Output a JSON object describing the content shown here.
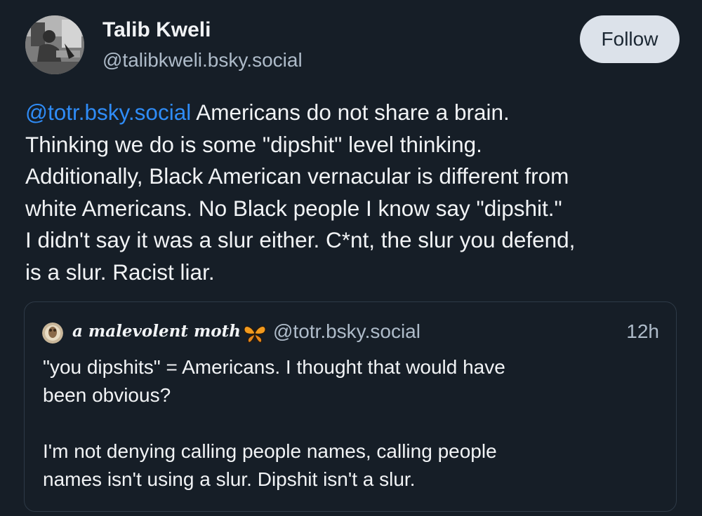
{
  "post": {
    "author": {
      "display_name": "Talib Kweli",
      "handle": "@talibkweli.bsky.social"
    },
    "follow_label": "Follow",
    "mention": "@totr.bsky.social",
    "text_lines": [
      " Americans do not share a brain.",
      "Thinking we do is some \"dipshit\" level thinking.",
      "Additionally, Black American vernacular is different from",
      "white Americans. No Black people I know say \"dipshit.\"",
      "I didn't say it was a slur either. C*nt, the slur you defend,",
      "is a slur. Racist liar."
    ]
  },
  "quote": {
    "display_name": "a malevolent moth",
    "name_emoji": "butterfly-icon",
    "handle": "@totr.bsky.social",
    "time": "12h",
    "text_lines": [
      "\"you dipshits\" = Americans. I thought that would have",
      "been obvious?",
      "",
      "I'm not denying calling people names, calling people",
      "names isn't using a slur. Dipshit isn't a slur."
    ]
  },
  "colors": {
    "background": "#161e27",
    "mention": "#2f8cf7",
    "muted_text": "#aebbc9",
    "follow_button_bg": "#dce2ea"
  }
}
